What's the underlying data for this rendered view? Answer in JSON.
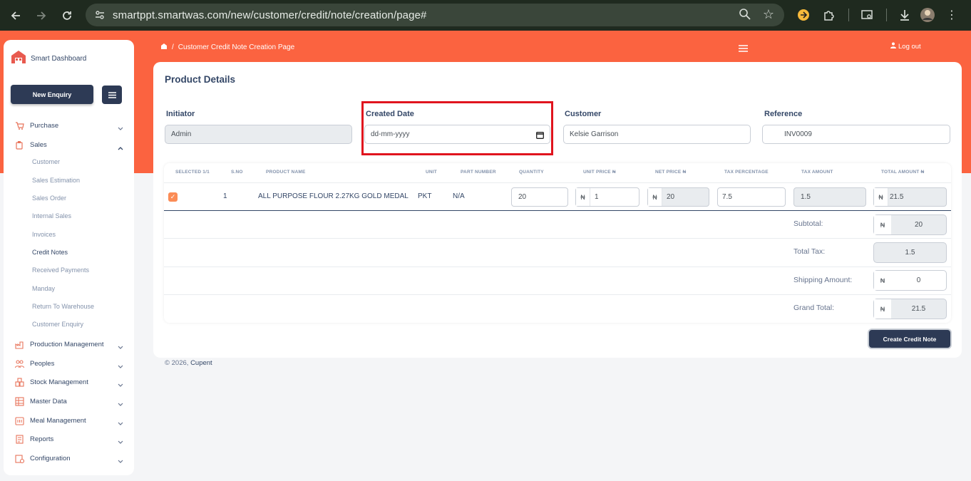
{
  "browser": {
    "url": "smartppt.smartwas.com/new/customer/credit/note/creation/page#"
  },
  "sidebar": {
    "brand": "Smart Dashboard",
    "new_enquiry": "New Enquiry",
    "items": [
      {
        "label": "Purchase",
        "icon": "cart-icon"
      },
      {
        "label": "Sales",
        "icon": "sales-icon"
      },
      {
        "label": "Production Management",
        "icon": "factory-icon"
      },
      {
        "label": "Peoples",
        "icon": "people-icon"
      },
      {
        "label": "Stock Management",
        "icon": "stock-icon"
      },
      {
        "label": "Master Data",
        "icon": "database-icon"
      },
      {
        "label": "Meal Management",
        "icon": "meal-icon"
      },
      {
        "label": "Reports",
        "icon": "reports-icon"
      },
      {
        "label": "Configuration",
        "icon": "config-icon"
      }
    ],
    "sales_sub": [
      "Customer",
      "Sales Estimation",
      "Sales Order",
      "Internal Sales",
      "Invoices",
      "Credit Notes",
      "Received Payments",
      "Manday",
      "Return To Warehouse",
      "Customer Enquiry"
    ]
  },
  "header": {
    "breadcrumb": "Customer Credit Note Creation Page",
    "logout": "Log out"
  },
  "card": {
    "title": "Product Details",
    "initiator_label": "Initiator",
    "initiator_value": "Admin",
    "created_date_label": "Created Date",
    "created_date_placeholder": "dd-mm-yyyy",
    "customer_label": "Customer",
    "customer_value": "Kelsie Garrison",
    "reference_label": "Reference",
    "reference_value": "INV0009"
  },
  "table": {
    "headers": [
      "SELECTED 1/1",
      "S.NO",
      "PRODUCT NAME",
      "UNIT",
      "PART NUMBER",
      "QUANTITY",
      "UNIT PRICE ₦",
      "NET PRICE ₦",
      "TAX PERCENTAGE",
      "TAX AMOUNT",
      "TOTAL AMOUNT ₦"
    ],
    "row": {
      "sno": "1",
      "product": "ALL PURPOSE FLOUR 2.27KG GOLD MEDAL",
      "unit": "PKT",
      "part": "N/A",
      "quantity": "20",
      "unit_price": "1",
      "net_price": "20",
      "tax_percentage": "7.5",
      "tax_amount": "1.5",
      "total_amount": "21.5"
    },
    "currency": "₦"
  },
  "summary": {
    "subtotal_label": "Subtotal:",
    "subtotal": "20",
    "tax_label": "Total Tax:",
    "tax": "1.5",
    "shipping_label": "Shipping Amount:",
    "shipping": "0",
    "grand_label": "Grand Total:",
    "grand": "21.5"
  },
  "actions": {
    "create": "Create Credit Note"
  },
  "footer": {
    "copyright": "© 2026,",
    "company": "Cupent"
  }
}
